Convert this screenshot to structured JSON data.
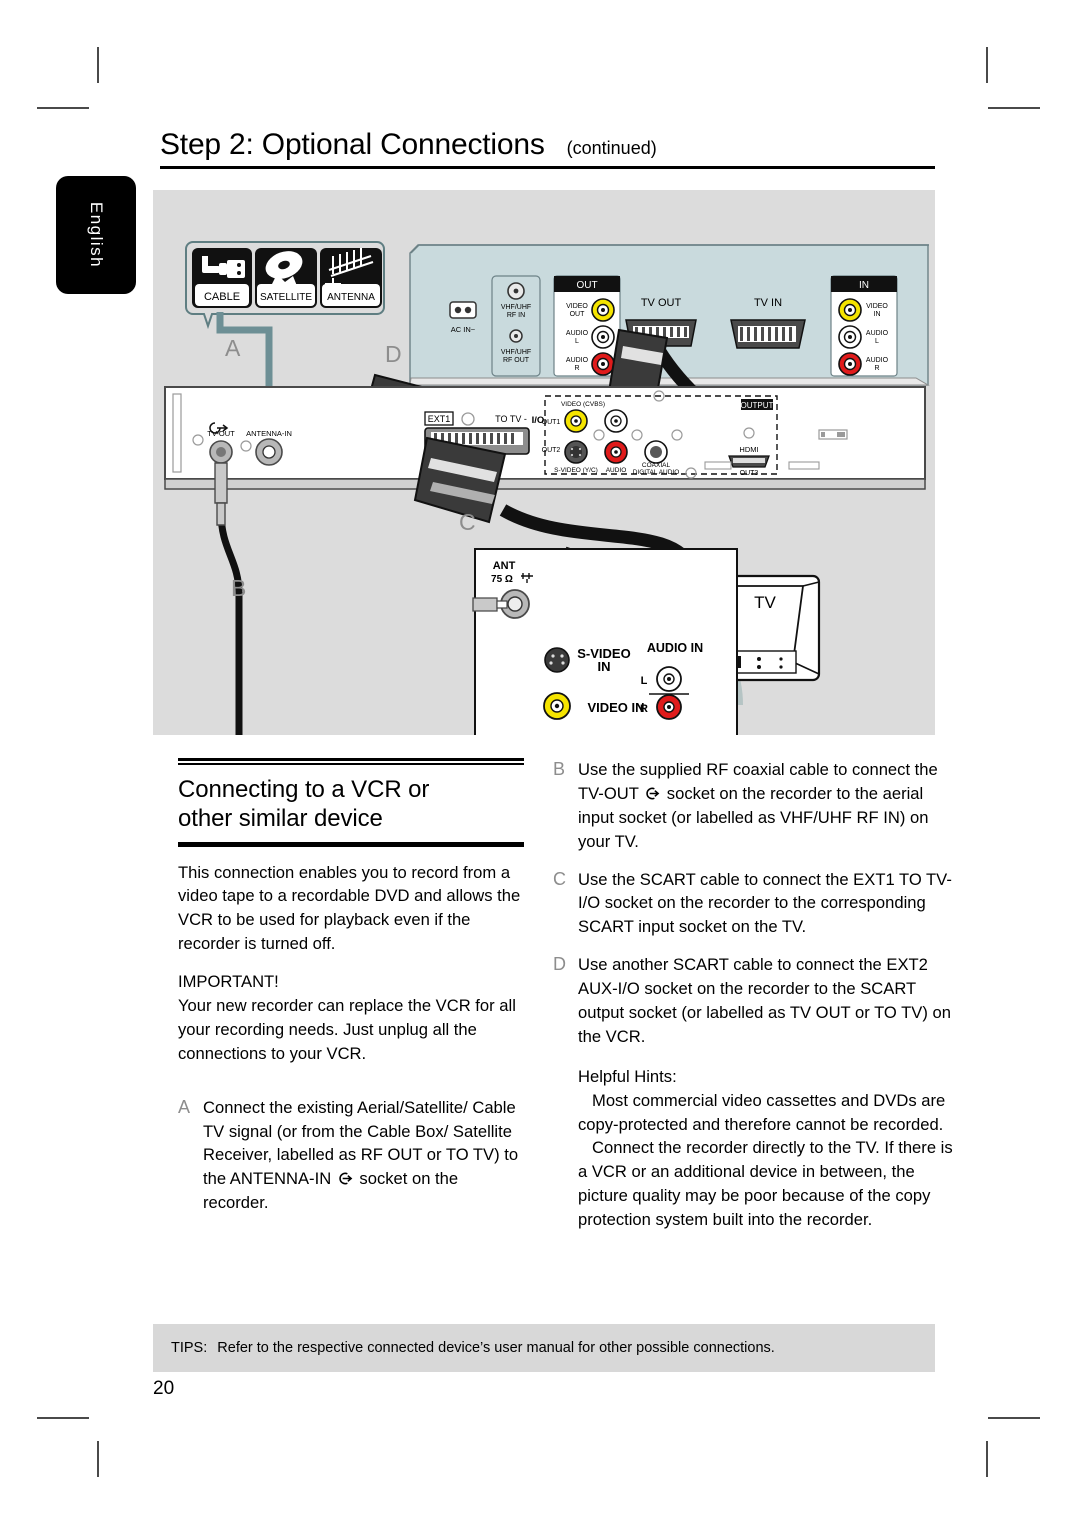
{
  "header": {
    "title": "Step 2: Optional Connections",
    "continued": "(continued)"
  },
  "sidebar": {
    "language_tab": "English"
  },
  "diagram": {
    "source_box": {
      "items": [
        {
          "label": "CABLE",
          "icon": "cable-icon"
        },
        {
          "label": "SATELLITE",
          "icon": "satellite-dish-icon"
        },
        {
          "label": "ANTENNA",
          "icon": "antenna-icon"
        }
      ]
    },
    "markers": [
      {
        "letter": "A"
      },
      {
        "letter": "B"
      },
      {
        "letter": "C"
      },
      {
        "letter": "D"
      }
    ],
    "vcr_panel": {
      "ac_in": "AC IN~",
      "rf_in": "VHF/UHF\nRF IN",
      "rf_out": "VHF/UHF\nRF OUT",
      "out_group_title": "OUT",
      "out_jacks": [
        {
          "label": "VIDEO\nOUT",
          "color": "#f5e400"
        },
        {
          "label": "AUDIO\nL",
          "color": "#ffffff"
        },
        {
          "label": "AUDIO\nR",
          "color": "#e01b1b"
        }
      ],
      "tv_out": "TV OUT",
      "tv_in": "TV IN",
      "in_group_title": "IN",
      "in_jacks": [
        {
          "label": "VIDEO\nIN",
          "color": "#f5e400"
        },
        {
          "label": "AUDIO\nL",
          "color": "#ffffff"
        },
        {
          "label": "AUDIO\nR",
          "color": "#e01b1b"
        }
      ]
    },
    "recorder_panel": {
      "tv_out": "TV-OUT",
      "antenna_in": "ANTENNA-IN",
      "ext1": "EXT1",
      "to_tv": "TO TV - I/O",
      "output_label": "OUTPUT",
      "video_cvbs": "VIDEO (CVBS)",
      "out1": "OUT1",
      "out2": "OUT2",
      "out3": "OUT3",
      "s_video": "S-VIDEO (Y/C)",
      "audio": "AUDIO",
      "coaxial": "COAXIAL\nDIGITAL AUDIO",
      "hdmi": "HDMI"
    },
    "tv_panel": {
      "ant": "ANT",
      "ant_ohm": "75 Ω",
      "s_video_in": "S-VIDEO\nIN",
      "video_in": "VIDEO IN",
      "audio_in": "AUDIO IN",
      "audio_l": "L",
      "audio_r": "R",
      "tv_label": "TV"
    }
  },
  "left_column": {
    "section_heading": "Connecting to a VCR or\nother similar device",
    "intro": "This connection enables you to record from a video tape to a recordable DVD and allows the VCR to be used for playback even if the recorder is turned off.",
    "important_label": "IMPORTANT!",
    "important_text": "Your new recorder can replace the VCR for all your recording needs. Just unplug all the connections to your VCR.",
    "step_a": {
      "marker": "A",
      "text_before": "Connect the existing Aerial/Satellite/ Cable TV signal (or from the Cable Box/ Satellite Receiver, labelled as RF OUT or TO TV) to the ANTENNA-IN",
      "icon": "antenna-in-arrow-icon",
      "text_after": "socket on the recorder."
    }
  },
  "right_column": {
    "step_b": {
      "marker": "B",
      "text_before": "Use the supplied RF coaxial cable to connect the TV-OUT",
      "icon": "tv-out-arrow-icon",
      "text_after": "socket on the recorder to the aerial input socket (or labelled as VHF/UHF RF IN) on your TV."
    },
    "step_c": {
      "marker": "C",
      "text": "Use the SCART cable to connect the EXT1 TO TV-I/O   socket on the recorder to the corresponding SCART input socket on the TV."
    },
    "step_d": {
      "marker": "D",
      "text": "Use another SCART cable to connect the EXT2 AUX-I/O   socket on the recorder to the SCART output socket (or labelled as TV OUT or TO TV) on the VCR."
    },
    "hints_label": "Helpful Hints:",
    "hint_1": "Most commercial video cassettes and DVDs are copy-protected and therefore cannot be recorded.",
    "hint_2": "Connect the recorder directly to the TV. If there is a VCR or an additional device in between, the picture quality may be poor because of the copy protection system built into the recorder."
  },
  "footer": {
    "tips_label": "TIPS:",
    "tips_text": "Refer to the respective connected device’s user manual for other possible connections.",
    "page_number": "20"
  }
}
